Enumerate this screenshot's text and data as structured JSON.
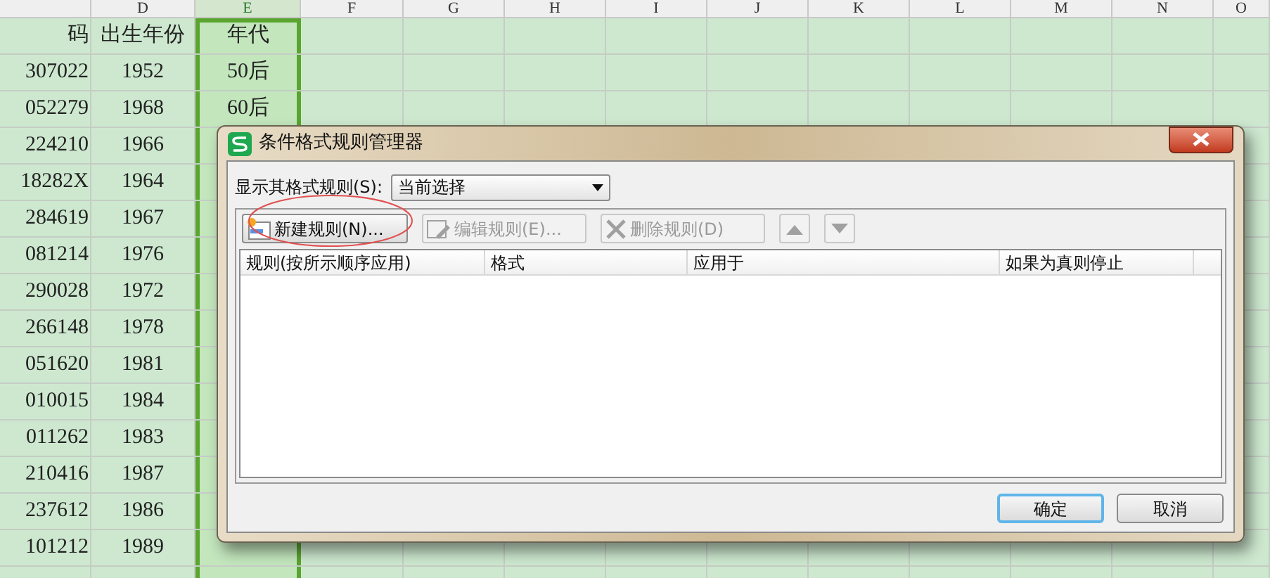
{
  "sheet": {
    "columns": [
      {
        "label": "D",
        "selected": false
      },
      {
        "label": "E",
        "selected": true
      },
      {
        "label": "F",
        "selected": false
      },
      {
        "label": "G",
        "selected": false
      },
      {
        "label": "H",
        "selected": false
      },
      {
        "label": "I",
        "selected": false
      },
      {
        "label": "J",
        "selected": false
      },
      {
        "label": "K",
        "selected": false
      },
      {
        "label": "L",
        "selected": false
      },
      {
        "label": "M",
        "selected": false
      },
      {
        "label": "N",
        "selected": false
      },
      {
        "label": "O",
        "selected": false
      }
    ],
    "rows": [
      {
        "c": "码",
        "d": "出生年份",
        "e": "年代"
      },
      {
        "c": "307022",
        "d": "1952",
        "e": "50后"
      },
      {
        "c": "052279",
        "d": "1968",
        "e": "60后"
      },
      {
        "c": "224210",
        "d": "1966"
      },
      {
        "c": "18282X",
        "d": "1964"
      },
      {
        "c": "284619",
        "d": "1967"
      },
      {
        "c": "081214",
        "d": "1976"
      },
      {
        "c": "290028",
        "d": "1972"
      },
      {
        "c": "266148",
        "d": "1978"
      },
      {
        "c": "051620",
        "d": "1981"
      },
      {
        "c": "010015",
        "d": "1984"
      },
      {
        "c": "011262",
        "d": "1983"
      },
      {
        "c": "210416",
        "d": "1987"
      },
      {
        "c": "237612",
        "d": "1986"
      },
      {
        "c": "101212",
        "d": "1989"
      },
      {}
    ]
  },
  "dialog": {
    "title": "条件格式规则管理器",
    "filter_label": "显示其格式规则(S):",
    "filter_value": "当前选择",
    "toolbar": [
      {
        "kind": "new",
        "label": "新建规则(N)...",
        "disabled": false
      },
      {
        "kind": "edit",
        "label": "编辑规则(E)...",
        "disabled": true
      },
      {
        "kind": "delete",
        "label": "删除规则(D)",
        "disabled": true
      },
      {
        "kind": "up",
        "disabled": true
      },
      {
        "kind": "down",
        "disabled": true
      }
    ],
    "columns": [
      "规则(按所示顺序应用)",
      "格式",
      "应用于",
      "如果为真则停止"
    ],
    "buttons": [
      {
        "label": "确定",
        "default": true
      },
      {
        "label": "取消",
        "default": false
      }
    ]
  }
}
